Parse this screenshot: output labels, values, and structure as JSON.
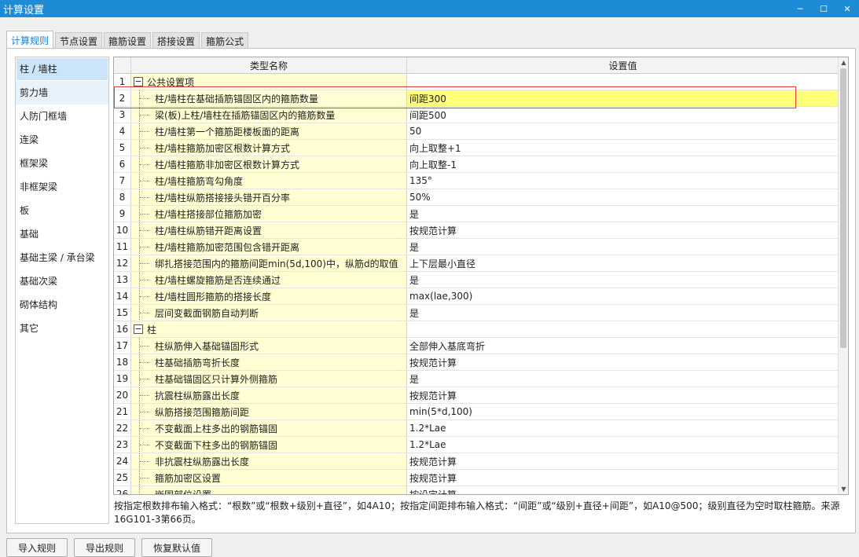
{
  "window": {
    "title": "计算设置",
    "minimize": "─",
    "maximize": "☐",
    "close": "✕"
  },
  "tabs": [
    {
      "label": "计算规则",
      "active": true
    },
    {
      "label": "节点设置",
      "active": false
    },
    {
      "label": "箍筋设置",
      "active": false
    },
    {
      "label": "搭接设置",
      "active": false
    },
    {
      "label": "箍筋公式",
      "active": false
    }
  ],
  "sidebar": {
    "items": [
      {
        "label": "柱 / 墙柱",
        "selected": true
      },
      {
        "label": "剪力墙"
      },
      {
        "label": "人防门框墙"
      },
      {
        "label": "连梁"
      },
      {
        "label": "框架梁"
      },
      {
        "label": "非框架梁"
      },
      {
        "label": "板"
      },
      {
        "label": "基础"
      },
      {
        "label": "基础主梁 / 承台梁"
      },
      {
        "label": "基础次梁"
      },
      {
        "label": "砌体结构"
      },
      {
        "label": "其它"
      }
    ]
  },
  "grid": {
    "columns": {
      "name": "类型名称",
      "value": "设置值"
    },
    "rows": [
      {
        "num": "1",
        "name": "公共设置项",
        "value": "",
        "group": true,
        "toggle": "−"
      },
      {
        "num": "2",
        "name": "柱/墙柱在基础插筋锚固区内的箍筋数量",
        "value": "间距300",
        "selected": true
      },
      {
        "num": "3",
        "name": "梁(板)上柱/墙柱在插筋锚固区内的箍筋数量",
        "value": "间距500"
      },
      {
        "num": "4",
        "name": "柱/墙柱第一个箍筋距楼板面的距离",
        "value": "50"
      },
      {
        "num": "5",
        "name": "柱/墙柱箍筋加密区根数计算方式",
        "value": "向上取整+1"
      },
      {
        "num": "6",
        "name": "柱/墙柱箍筋非加密区根数计算方式",
        "value": "向上取整-1"
      },
      {
        "num": "7",
        "name": "柱/墙柱箍筋弯勾角度",
        "value": "135°"
      },
      {
        "num": "8",
        "name": "柱/墙柱纵筋搭接接头错开百分率",
        "value": "50%"
      },
      {
        "num": "9",
        "name": "柱/墙柱搭接部位箍筋加密",
        "value": "是"
      },
      {
        "num": "10",
        "name": "柱/墙柱纵筋错开距离设置",
        "value": "按规范计算"
      },
      {
        "num": "11",
        "name": "柱/墙柱箍筋加密范围包含错开距离",
        "value": "是"
      },
      {
        "num": "12",
        "name": "绑扎搭接范围内的箍筋间距min(5d,100)中，纵筋d的取值",
        "value": "上下层最小直径"
      },
      {
        "num": "13",
        "name": "柱/墙柱螺旋箍筋是否连续通过",
        "value": "是"
      },
      {
        "num": "14",
        "name": "柱/墙柱圆形箍筋的搭接长度",
        "value": "max(lae,300)"
      },
      {
        "num": "15",
        "name": "层间变截面钢筋自动判断",
        "value": "是"
      },
      {
        "num": "16",
        "name": "柱",
        "value": "",
        "group": true,
        "toggle": "−"
      },
      {
        "num": "17",
        "name": "柱纵筋伸入基础锚固形式",
        "value": "全部伸入基底弯折"
      },
      {
        "num": "18",
        "name": "柱基础插筋弯折长度",
        "value": "按规范计算"
      },
      {
        "num": "19",
        "name": "柱基础锚固区只计算外侧箍筋",
        "value": "是"
      },
      {
        "num": "20",
        "name": "抗震柱纵筋露出长度",
        "value": "按规范计算"
      },
      {
        "num": "21",
        "name": "纵筋搭接范围箍筋间距",
        "value": "min(5*d,100)"
      },
      {
        "num": "22",
        "name": "不变截面上柱多出的钢筋锚固",
        "value": "1.2*Lae"
      },
      {
        "num": "23",
        "name": "不变截面下柱多出的钢筋锚固",
        "value": "1.2*Lae"
      },
      {
        "num": "24",
        "name": "非抗震柱纵筋露出长度",
        "value": "按规范计算"
      },
      {
        "num": "25",
        "name": "箍筋加密区设置",
        "value": "按规范计算"
      },
      {
        "num": "26",
        "name": "嵌固部位设置",
        "value": "按设定计算"
      }
    ]
  },
  "note": "按指定根数排布输入格式：“根数”或“根数+级别+直径”，如4A10；按指定间距排布输入格式：“间距”或“级别+直径+间距”，如A10@500；级别直径为空时取柱箍筋。来源16G101-3第66页。",
  "buttons": {
    "import": "导入规则",
    "export": "导出规则",
    "restore": "恢复默认值"
  }
}
